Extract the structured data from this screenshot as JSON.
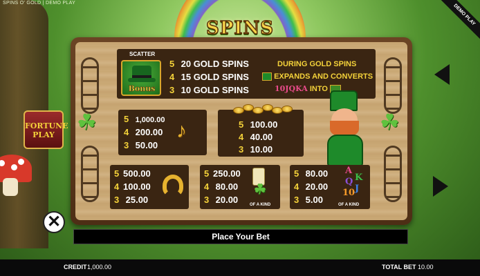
{
  "header": {
    "game_title": "SPINS O' GOLD | DEMO PLAY",
    "demo_ribbon": "DEMO PLAY",
    "logo_text": "SPINS O'GOLD"
  },
  "scatter": {
    "label": "SCATTER",
    "symbol_text": "Bonus",
    "pays": [
      {
        "count": "5",
        "text": "20 GOLD SPINS"
      },
      {
        "count": "4",
        "text": "15 GOLD SPINS"
      },
      {
        "count": "3",
        "text": "10 GOLD SPINS"
      }
    ],
    "feature_line1": "DURING GOLD SPINS",
    "feature_line2": "EXPANDS AND CONVERTS",
    "feature_line3_letters": "10JQKA",
    "feature_line3": "INTO"
  },
  "harp": {
    "icon": "harp-icon",
    "pays": [
      {
        "count": "5",
        "value": "1,000.00"
      },
      {
        "count": "4",
        "value": "200.00"
      },
      {
        "count": "3",
        "value": "50.00"
      }
    ]
  },
  "pot_of_gold": {
    "icon": "pot-of-gold-icon",
    "pays": [
      {
        "count": "5",
        "value": "100.00"
      },
      {
        "count": "4",
        "value": "40.00"
      },
      {
        "count": "3",
        "value": "10.00"
      }
    ]
  },
  "horseshoe": {
    "icon": "horseshoe-icon",
    "pays": [
      {
        "count": "5",
        "value": "500.00"
      },
      {
        "count": "4",
        "value": "100.00"
      },
      {
        "count": "3",
        "value": "25.00"
      }
    ]
  },
  "ale_clover": {
    "icon": "ale-and-clover-icon",
    "pays": [
      {
        "count": "5",
        "value": "250.00"
      },
      {
        "count": "4",
        "value": "80.00"
      },
      {
        "count": "3",
        "value": "20.00"
      }
    ],
    "of_a_kind": "OF A KIND"
  },
  "letters": {
    "symbols": [
      "A",
      "K",
      "Q",
      "J",
      "10"
    ],
    "pays": [
      {
        "count": "5",
        "value": "80.00"
      },
      {
        "count": "4",
        "value": "20.00"
      },
      {
        "count": "3",
        "value": "5.00"
      }
    ],
    "of_a_kind": "OF A KIND"
  },
  "side": {
    "fortune_play_line1": "FORTUNE",
    "fortune_play_line2": "PLAY",
    "close_glyph": "✕"
  },
  "bet_bar": {
    "message": "Place Your Bet"
  },
  "footer": {
    "credit_label": "CREDIT",
    "credit_value": "1,000.00",
    "total_bet_label": "TOTAL BET",
    "total_bet_value": "10.00"
  },
  "colors": {
    "gold": "#f4d23a",
    "panel": "#3a2512",
    "wood": "#c8a672",
    "clover_green": "#5fc23e"
  }
}
